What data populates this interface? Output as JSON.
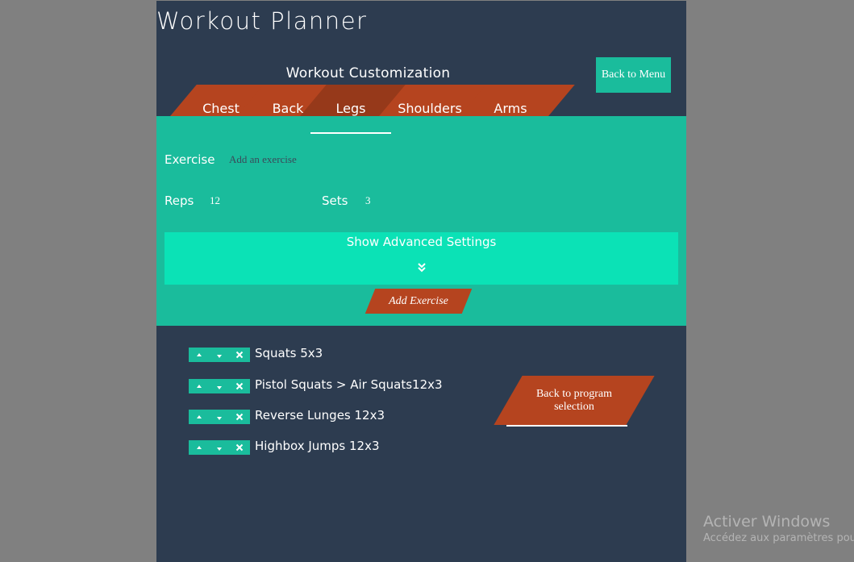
{
  "app": {
    "title": "Workout Planner",
    "section_title": "Workout Customization",
    "back_menu_label": "Back to Menu"
  },
  "tabs": [
    {
      "label": "Chest",
      "active": false
    },
    {
      "label": "Back",
      "active": false
    },
    {
      "label": "Legs",
      "active": true
    },
    {
      "label": "Shoulders",
      "active": false
    },
    {
      "label": "Arms",
      "active": false
    }
  ],
  "form": {
    "exercise_label": "Exercise",
    "exercise_placeholder": "Add an exercise",
    "reps_label": "Reps",
    "reps_value": "12",
    "sets_label": "Sets",
    "sets_value": "3",
    "advanced_label": "Show Advanced Settings",
    "add_label": "Add Exercise"
  },
  "exercises": [
    {
      "text": "Squats 5x3"
    },
    {
      "text": "Pistol Squats > Air Squats12x3"
    },
    {
      "text": "Reverse Lunges 12x3"
    },
    {
      "text": "Highbox Jumps 12x3"
    }
  ],
  "back_program_label": "Back to program selection",
  "watermark": {
    "line1": "Activer Windows",
    "line2": "Accédez aux paramètres pou"
  },
  "colors": {
    "background": "#808080",
    "app_bg": "#2d3c50",
    "teal": "#1abc9c",
    "teal_light": "#0be2b6",
    "orange": "#b5441f",
    "orange_active": "#96391a"
  },
  "icons": [
    "chevron-up-icon",
    "chevron-down-icon",
    "close-icon",
    "double-chevron-down-icon"
  ]
}
